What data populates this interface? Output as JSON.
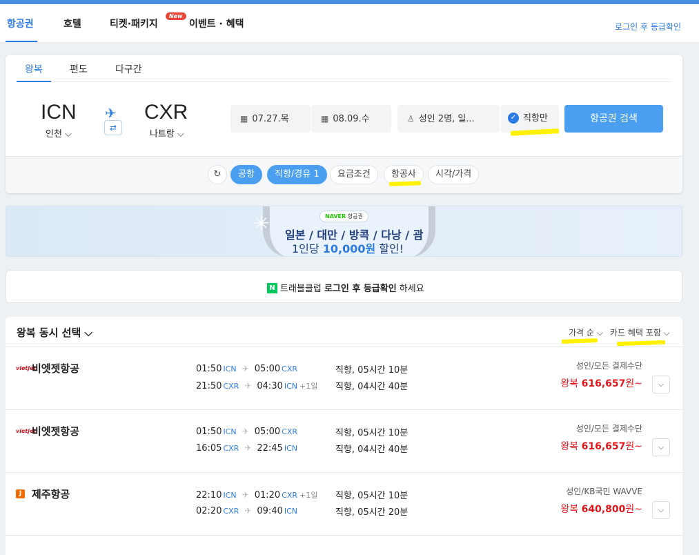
{
  "nav": {
    "items": [
      {
        "label": "항공권"
      },
      {
        "label": "호텔"
      },
      {
        "label": "티켓·패키지"
      },
      {
        "label": "이벤트 · 혜택"
      }
    ],
    "new_badge": "New",
    "login_link": "로그인 후 등급확인"
  },
  "search": {
    "trip_tabs": [
      {
        "label": "왕복"
      },
      {
        "label": "편도"
      },
      {
        "label": "다구간"
      }
    ],
    "origin": {
      "code": "ICN",
      "city": "인천 ⌵"
    },
    "destination": {
      "code": "CXR",
      "city": "나트랑 ⌵"
    },
    "depart_date": "07.27.목",
    "return_date": "08.09.수",
    "passengers": "성인 2명, 일...",
    "direct_only": "직항만",
    "search_button": "항공권 검색"
  },
  "filters": {
    "chips": [
      {
        "label": "공항"
      },
      {
        "label": "직항/경유 1"
      },
      {
        "label": "요금조건"
      },
      {
        "label": "항공사"
      },
      {
        "label": "시각/가격"
      }
    ]
  },
  "banner": {
    "badge_brand": "NAVER",
    "badge_text": "항공권",
    "line1": "일본 / 대만 / 방콕 / 다낭 / 괌",
    "line2_prefix": "1인당 ",
    "line2_amount": "10,000원",
    "line2_suffix": " 할인!"
  },
  "login_notice": {
    "logo": "N",
    "prefix": "트래블클럽 ",
    "bold": "로그인 후 등급확인",
    "suffix": " 하세요"
  },
  "results": {
    "title": "왕복 동시 선택 ⌵",
    "sort_price": "가격 순 ⌵",
    "sort_card": "카드 혜택 포함 ⌵",
    "items": [
      {
        "airline": "비엣젯항공",
        "logo": "vietjet",
        "out": {
          "dep_time": "01:50",
          "dep_ap": "ICN",
          "arr_time": "05:00",
          "arr_ap": "CXR",
          "plus": ""
        },
        "ret": {
          "dep_time": "21:50",
          "dep_ap": "CXR",
          "arr_time": "04:30",
          "arr_ap": "ICN",
          "plus": "+1일"
        },
        "out_dur": "직항, 05시간 10분",
        "ret_dur": "직항, 04시간 40분",
        "condition": "성인/모든 결제수단",
        "price_label": "왕복 ",
        "price_amount": "616,657",
        "price_suffix": "원~"
      },
      {
        "airline": "비엣젯항공",
        "logo": "vietjet",
        "out": {
          "dep_time": "01:50",
          "dep_ap": "ICN",
          "arr_time": "05:00",
          "arr_ap": "CXR",
          "plus": ""
        },
        "ret": {
          "dep_time": "16:05",
          "dep_ap": "CXR",
          "arr_time": "22:45",
          "arr_ap": "ICN",
          "plus": ""
        },
        "out_dur": "직항, 05시간 10분",
        "ret_dur": "직항, 04시간 40분",
        "condition": "성인/모든 결제수단",
        "price_label": "왕복 ",
        "price_amount": "616,657",
        "price_suffix": "원~"
      },
      {
        "airline": "제주항공",
        "logo": "J",
        "out": {
          "dep_time": "22:10",
          "dep_ap": "ICN",
          "arr_time": "01:20",
          "arr_ap": "CXR",
          "plus": "+1일"
        },
        "ret": {
          "dep_time": "02:20",
          "dep_ap": "CXR",
          "arr_time": "09:40",
          "arr_ap": "ICN",
          "plus": ""
        },
        "out_dur": "직항, 05시간 10분",
        "ret_dur": "직항, 05시간 20분",
        "condition": "성인/KB국민 WAVVE",
        "price_label": "왕복 ",
        "price_amount": "640,800",
        "price_suffix": "원~"
      }
    ]
  },
  "colors": {
    "accent": "#2d7be5",
    "button": "#4a9ff0",
    "price": "#e4161c",
    "highlight": "#fff200"
  },
  "icons": {
    "plane": "plane-icon",
    "swap": "swap-icon",
    "calendar": "calendar-icon",
    "person": "person-icon",
    "check": "check-circle-icon",
    "refresh": "refresh-icon",
    "chevron": "chevron-down-icon"
  }
}
